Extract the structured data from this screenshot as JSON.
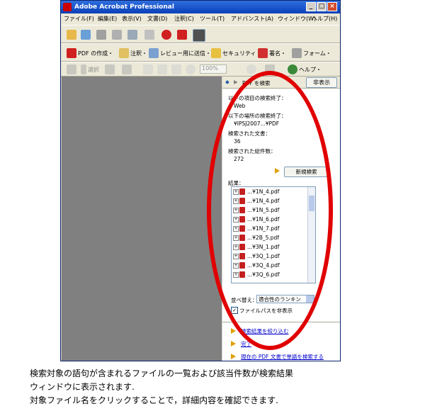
{
  "window": {
    "title": "Adobe Acrobat Professional"
  },
  "menu": [
    "ファイル(F)",
    "編集(E)",
    "表示(V)",
    "文書(D)",
    "注釈(C)",
    "ツール(T)",
    "アドバンスト(A)",
    "ウィンドウ(W)",
    "ヘルプ(H)"
  ],
  "toolbar2": {
    "create_pdf": "PDF の作成・",
    "comment": "注釈・",
    "send_review": "レビュー用に送信・",
    "security": "セキュリティ・",
    "sign": "署名・",
    "forms": "フォーム・"
  },
  "toolbar3": {
    "select": "選択",
    "zoom": "100%",
    "help": "ヘルプ・"
  },
  "panel": {
    "title": "PDF を検索",
    "hide_button": "非表示",
    "search_done_label": "以下の項目の検索終了：",
    "search_term": "Web",
    "location_label": "以下の場所の検索終了：",
    "location": "¥IPSJ2007...¥PDF",
    "docs_label": "検索された文書：",
    "docs_count": "36",
    "instances_label": "検索された総件数：",
    "instances_count": "272",
    "new_search": "新規検索",
    "results_label": "結果：",
    "results": [
      "...¥1N_4.pdf",
      "...¥1N_4.pdf",
      "...¥1N_5.pdf",
      "...¥1N_6.pdf",
      "...¥1N_7.pdf",
      "...¥2B_5.pdf",
      "...¥3N_1.pdf",
      "...¥3Q_1.pdf",
      "...¥3Q_4.pdf",
      "...¥3Q_6.pdf"
    ],
    "sort_label": "並べ替え：",
    "sort_value": "適合性のランキン",
    "hide_path": "ファイルパスを非表示",
    "links": [
      "検索結果を絞り込む",
      "完了",
      "現在の PDF 文書で単語を検索する"
    ]
  },
  "captions": [
    "検索対象の語句が含まれるファイルの一覧および該当件数が検索結果",
    "ウィンドウに表示されます.",
    "対象ファイル名をクリックすることで，詳細内容を確認できます."
  ],
  "colors": {
    "highlight_oval": "#e10000",
    "titlebar": "#0a3fb8",
    "link": "#0000cc"
  }
}
